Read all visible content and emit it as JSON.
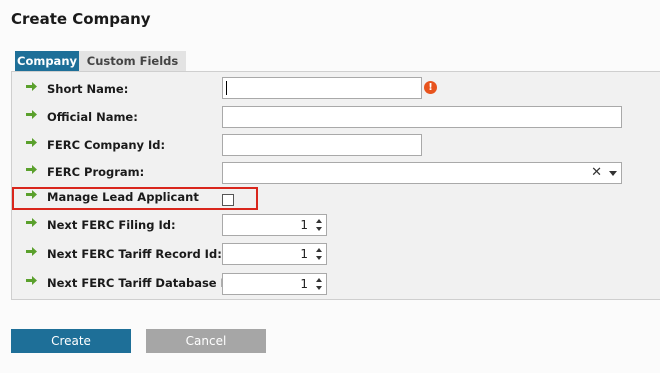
{
  "page": {
    "title": "Create Company"
  },
  "tabs": [
    {
      "label": "Company"
    },
    {
      "label": "Custom Fields"
    }
  ],
  "form": {
    "short_name": {
      "label": "Short Name:",
      "value": "",
      "error_icon": "!"
    },
    "official_name": {
      "label": "Official Name:",
      "value": ""
    },
    "ferc_company_id": {
      "label": "FERC Company Id:",
      "value": ""
    },
    "ferc_program": {
      "label": "FERC Program:",
      "value": "",
      "clear_icon": "✕"
    },
    "manage_lead_applicant": {
      "label": "Manage Lead Applicant",
      "checked": false
    },
    "next_ferc_filing_id": {
      "label": "Next FERC Filing Id:",
      "value": "1"
    },
    "next_ferc_tariff_record_id": {
      "label": "Next FERC Tariff Record Id:",
      "value": "1"
    },
    "next_ferc_tariff_database_id": {
      "label": "Next FERC Tariff Database Id:",
      "value": "1"
    }
  },
  "buttons": {
    "create": "Create",
    "cancel": "Cancel"
  },
  "icons": {
    "row_arrow": "green-arrow-icon",
    "error": "error-icon"
  },
  "colors": {
    "accent": "#1e6f98",
    "arrow": "#5aa02c",
    "error": "#e8541e",
    "highlight": "#d9261c",
    "cancel": "#a6a6a6"
  }
}
